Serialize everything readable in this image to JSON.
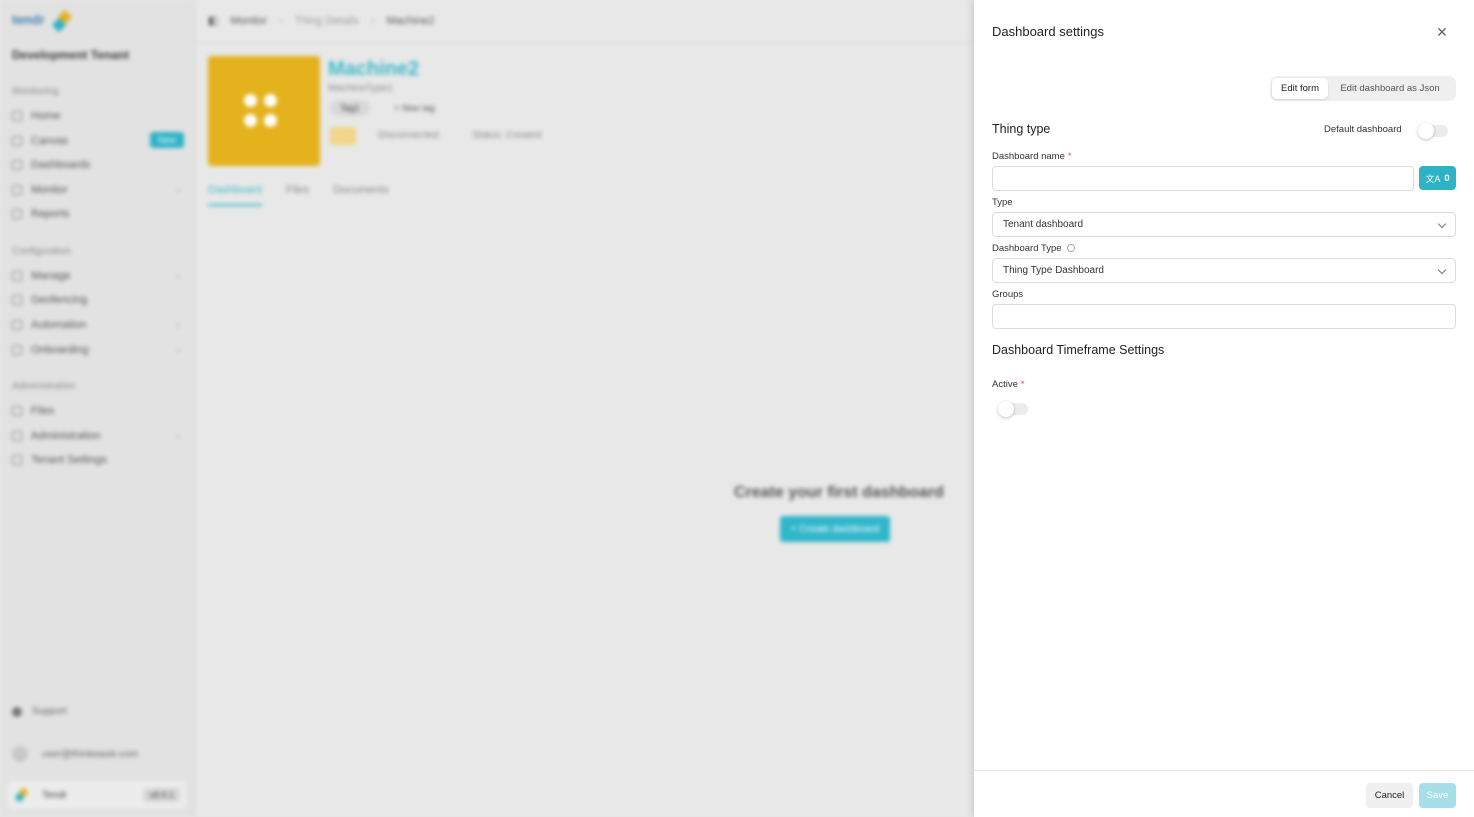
{
  "background": {
    "sidebar": {
      "logo": "tendr",
      "tenant": "Development Tenant",
      "sections": [
        {
          "label": "Monitoring",
          "items": [
            {
              "label": "Home"
            },
            {
              "label": "Canvas",
              "badge": "New"
            },
            {
              "label": "Dashboards"
            },
            {
              "label": "Monitor",
              "chevron": true
            },
            {
              "label": "Reports"
            }
          ]
        },
        {
          "label": "Configuration",
          "items": [
            {
              "label": "Manage",
              "chevron": true
            },
            {
              "label": "Geofencing"
            },
            {
              "label": "Automation",
              "chevron": true
            },
            {
              "label": "Onboarding",
              "chevron": true
            }
          ]
        },
        {
          "label": "Administration",
          "items": [
            {
              "label": "Files"
            },
            {
              "label": "Administration",
              "chevron": true
            },
            {
              "label": "Tenant Settings"
            }
          ]
        }
      ],
      "support": "Support",
      "user_email": "user@thinkeasie.com",
      "footer_name": "Tendr",
      "footer_version": "v8.9.1"
    },
    "breadcrumb": [
      "Monitor",
      "Thing Details",
      "Machine2"
    ],
    "thing": {
      "title": "Machine2",
      "subtitle": "MachineType1",
      "tag": "Tag1",
      "new_tag": "+ New tag",
      "status_disconnected": "Disconnected",
      "status_created": "Status: Created"
    },
    "tabs": [
      "Dashboard",
      "Files",
      "Documents"
    ],
    "empty_state": {
      "title": "Create your first dashboard",
      "button": "+ Create dashboard"
    }
  },
  "panel": {
    "title": "Dashboard settings",
    "close_icon": "close-icon",
    "mode_tabs": {
      "edit_form": "Edit form",
      "edit_json": "Edit dashboard as Json"
    },
    "section_title": "Thing type",
    "default_dashboard_label": "Default dashboard",
    "default_dashboard_on": false,
    "dashboard_name": {
      "label": "Dashboard name",
      "required": "*",
      "value": "",
      "placeholder": ""
    },
    "translate_button": {
      "icon": "translate-icon",
      "count": "0"
    },
    "type": {
      "label": "Type",
      "value": "Tenant dashboard"
    },
    "dashboard_type": {
      "label": "Dashboard Type",
      "value": "Thing Type Dashboard"
    },
    "groups": {
      "label": "Groups",
      "value": ""
    },
    "timeframe_title": "Dashboard Timeframe Settings",
    "active": {
      "label": "Active",
      "required": "*",
      "on": false
    },
    "footer": {
      "cancel": "Cancel",
      "save": "Save"
    },
    "accent_color": "#2db2c6"
  }
}
